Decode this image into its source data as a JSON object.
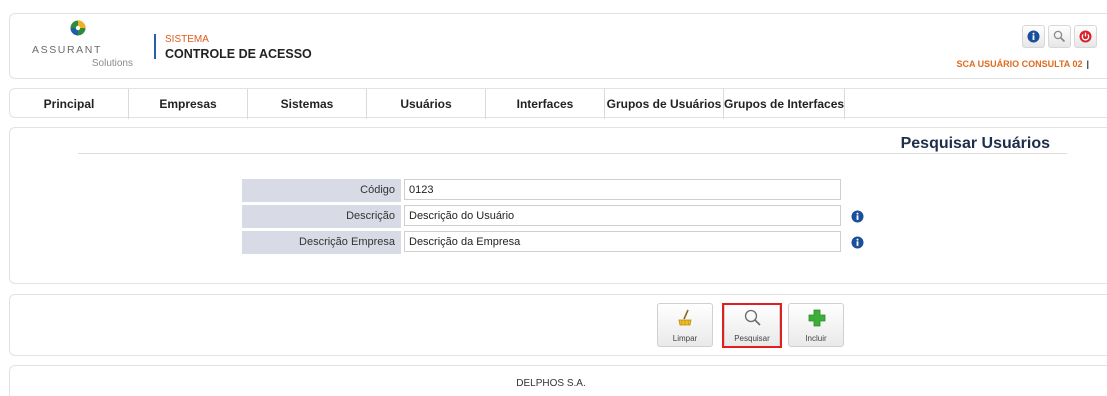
{
  "brand": {
    "name": "ASSURANT",
    "tagline": "Solutions"
  },
  "system": {
    "label": "SISTEMA",
    "title": "CONTROLE DE ACESSO"
  },
  "header": {
    "user_label": "SCA USUÁRIO CONSULTA 02",
    "separator": "|",
    "icons": [
      "info-icon",
      "search-icon",
      "power-icon"
    ]
  },
  "nav": {
    "items": [
      {
        "label": "Principal"
      },
      {
        "label": "Empresas"
      },
      {
        "label": "Sistemas"
      },
      {
        "label": "Usuários"
      },
      {
        "label": "Interfaces"
      },
      {
        "label": "Grupos de Usuários"
      },
      {
        "label": "Grupos de Interfaces"
      }
    ]
  },
  "search": {
    "title": "Pesquisar Usuários",
    "fields": [
      {
        "label": "Código",
        "value": "0123",
        "info": false
      },
      {
        "label": "Descrição",
        "value": "Descrição do Usuário",
        "info": true
      },
      {
        "label": "Descrição Empresa",
        "value": "Descrição da Empresa",
        "info": true
      }
    ]
  },
  "actions": {
    "clear_label": "Limpar",
    "search_label": "Pesquisar",
    "add_label": "Incluir"
  },
  "footer": {
    "text": "DELPHOS S.A."
  },
  "colors": {
    "accent": "#e05a1e",
    "label_bg": "#d8dbe6",
    "title": "#1d2e4a",
    "highlight": "#e02020"
  }
}
